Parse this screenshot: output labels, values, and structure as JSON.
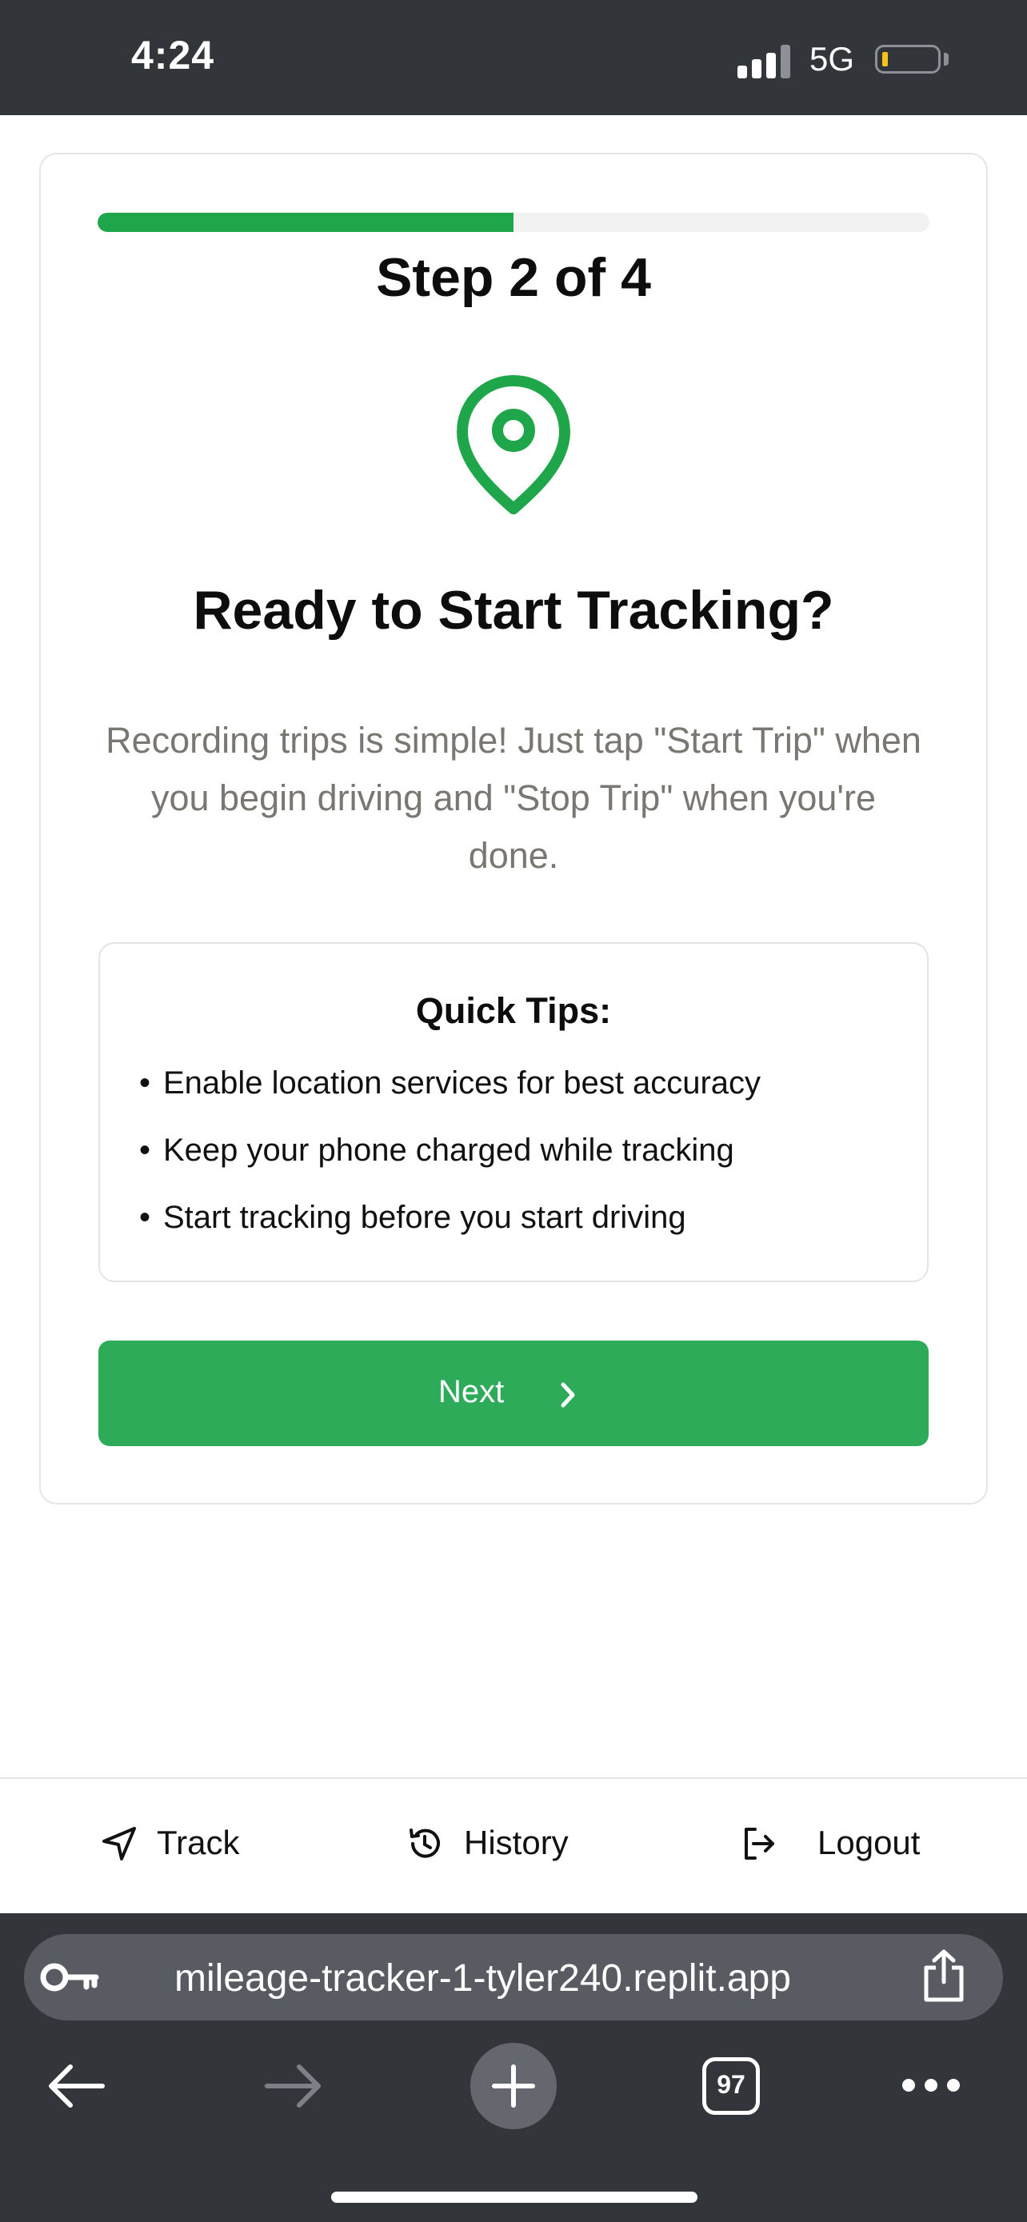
{
  "status_bar": {
    "time": "4:24",
    "network": "5G",
    "signal_icon": "cellular-signal-icon",
    "battery_icon": "battery-low-icon",
    "battery_color": "#f7c21b"
  },
  "onboarding": {
    "progress_fraction": 0.5,
    "step_label": "Step 2 of 4",
    "icon": "map-pin-icon",
    "title": "Ready to Start Tracking?",
    "description": "Recording trips is simple! Just tap \"Start Trip\" when you begin driving and \"Stop Trip\" when you're done.",
    "tips": {
      "title": "Quick Tips:",
      "items": [
        "Enable location services for best accuracy",
        "Keep your phone charged while tracking",
        "Start tracking before you start driving"
      ]
    },
    "next_button": {
      "label": "Next",
      "icon": "chevron-right-icon"
    },
    "accent_color": "#2eab59"
  },
  "bottom_nav": {
    "track": {
      "label": "Track",
      "icon": "navigation-arrow-icon"
    },
    "history": {
      "label": "History",
      "icon": "history-icon"
    },
    "logout": {
      "label": "Logout",
      "icon": "logout-icon"
    }
  },
  "browser": {
    "url": "mileage-tracker-1-tyler240.replit.app",
    "tab_count": "97",
    "icons": [
      "key-icon",
      "share-icon",
      "back-arrow-icon",
      "forward-arrow-icon",
      "plus-icon",
      "tabs-icon",
      "more-icon"
    ]
  }
}
